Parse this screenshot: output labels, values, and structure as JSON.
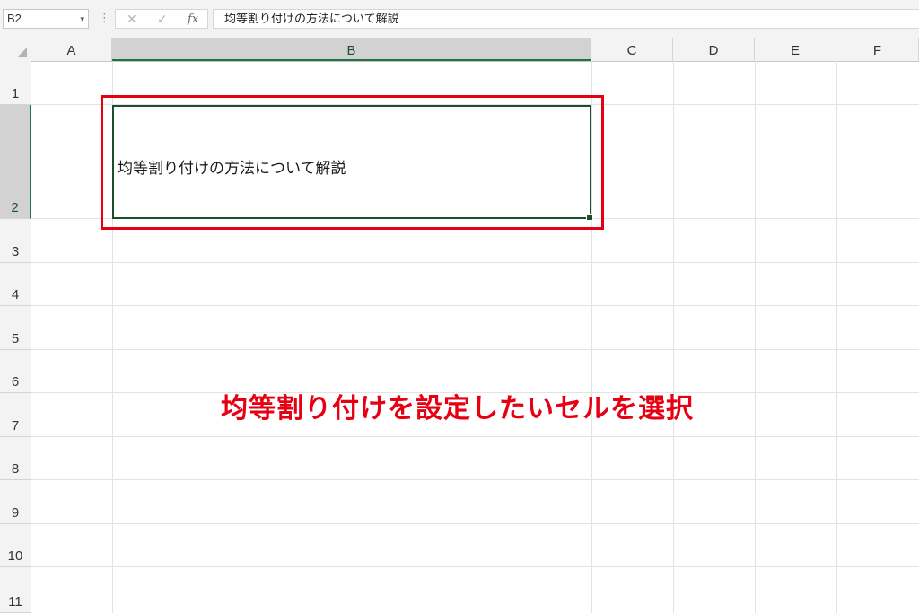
{
  "formula_bar": {
    "name_box": "B2",
    "name_box_arrow": "▾",
    "dots": "⋮",
    "cancel_icon": "✕",
    "enter_icon": "✓",
    "fx": "fx",
    "formula": "均等割り付けの方法について解説"
  },
  "columns": [
    "A",
    "B",
    "C",
    "D",
    "E",
    "F"
  ],
  "rows": [
    "1",
    "2",
    "3",
    "4",
    "5",
    "6",
    "7",
    "8",
    "9",
    "10",
    "11"
  ],
  "selected_cell": {
    "ref": "B2",
    "value": "均等割り付けの方法について解説"
  },
  "annotation": "均等割り付けを設定したいセルを選択",
  "colors": {
    "highlight": "#e60012",
    "selection": "#1e4d2b",
    "header_bg": "#f3f3f3"
  }
}
